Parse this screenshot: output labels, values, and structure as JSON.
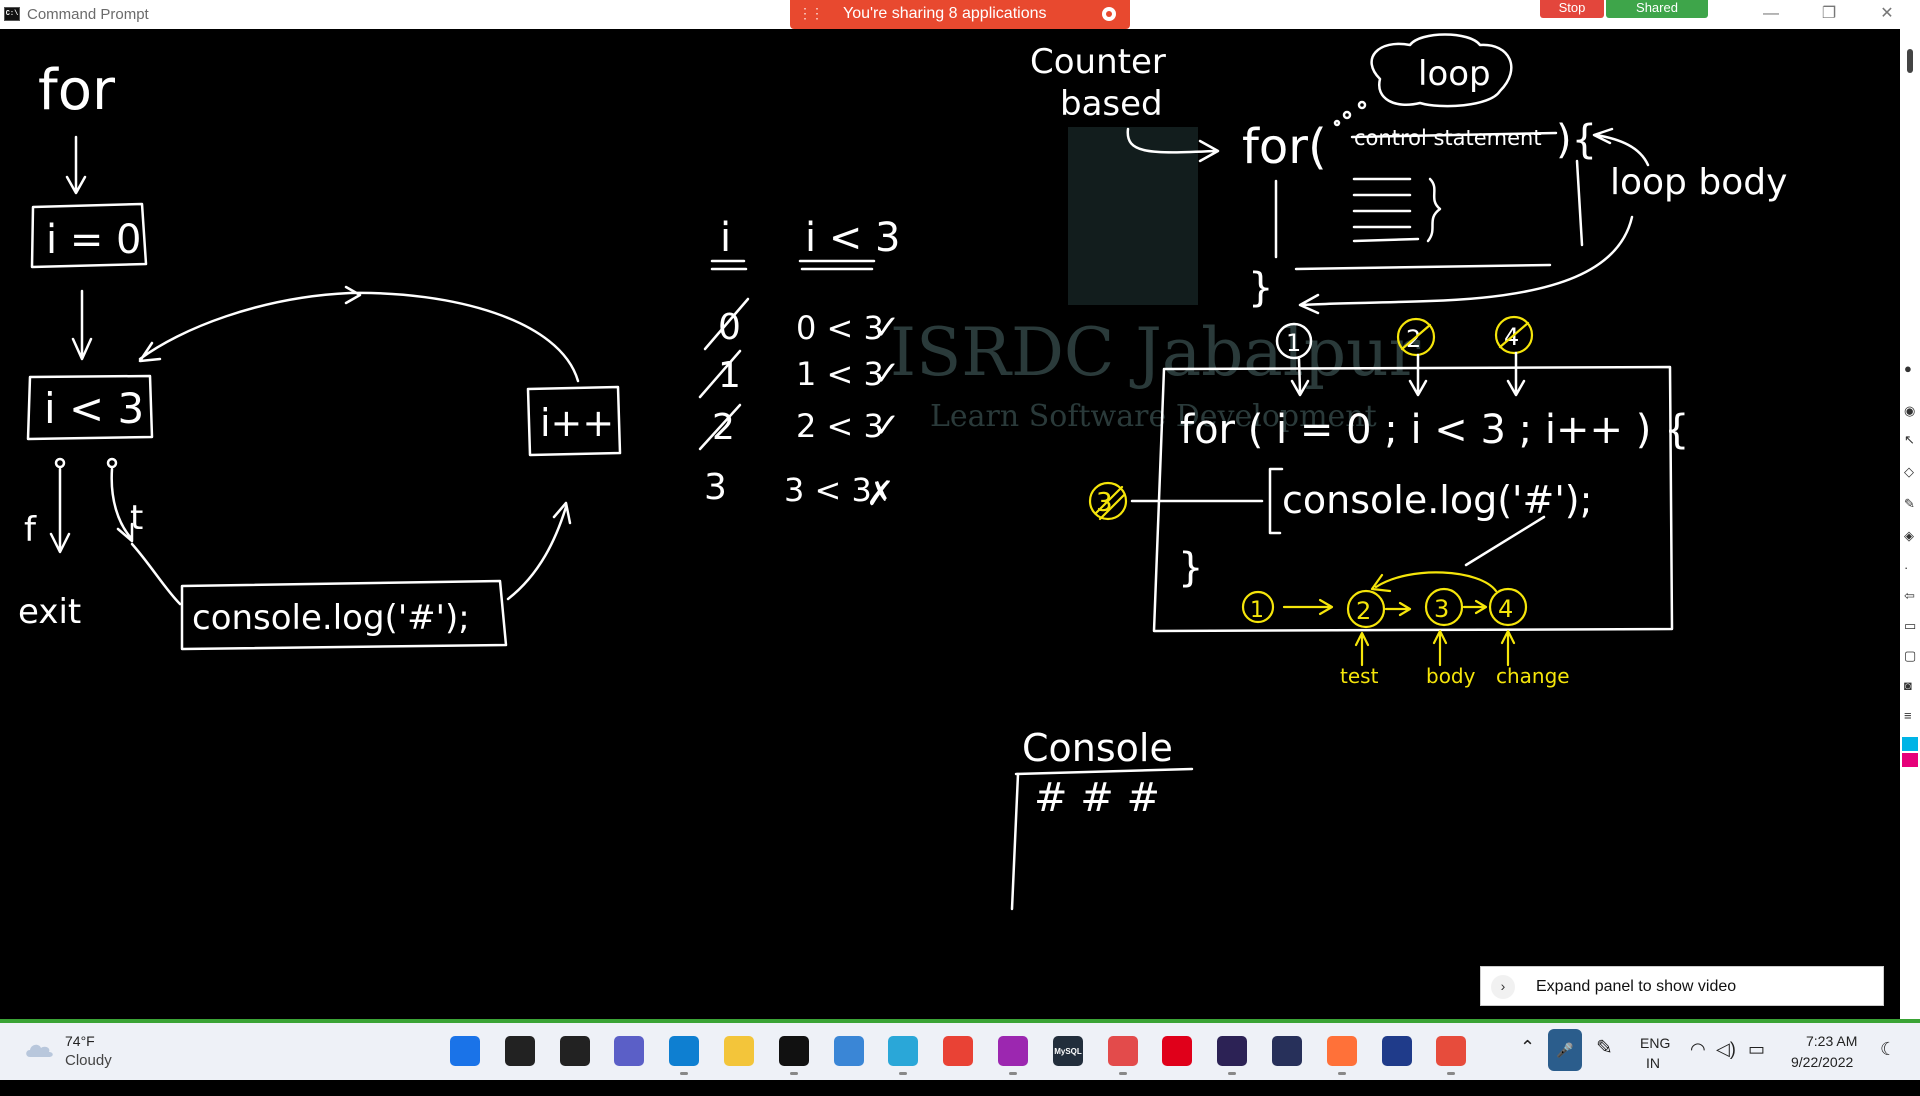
{
  "window": {
    "title": "Command Prompt",
    "icon": "cmd-icon"
  },
  "share_banner": {
    "text": "You're sharing 8 applications",
    "stop_label": "Stop",
    "shared_label": "Shared"
  },
  "window_controls": {
    "minimize": "—",
    "restore": "❐",
    "close": "✕"
  },
  "watermark": {
    "name": "ISRDC Jabalpur",
    "tagline": "Learn Software Development"
  },
  "board": {
    "flowchart": {
      "title": "for",
      "init": "i = 0",
      "condition": "i < 3",
      "update": "i++",
      "false_label": "f",
      "true_label": "t",
      "exit_label": "exit",
      "body": "console.log('#');"
    },
    "trace_table": {
      "headers": [
        "i",
        "i < 3"
      ],
      "rows": [
        {
          "i": "0",
          "test": "0 < 3",
          "result": "✓"
        },
        {
          "i": "1",
          "test": "1 < 3",
          "result": "✓"
        },
        {
          "i": "2",
          "test": "2 < 3",
          "result": "✓"
        },
        {
          "i": "3",
          "test": "3 < 3",
          "result": "✗"
        }
      ]
    },
    "syntax": {
      "counter_based": [
        "Counter",
        "based"
      ],
      "keyword": "for(",
      "control_statement": "control statement",
      "brace": "){",
      "close_brace": "}",
      "loop_cloud": "loop",
      "loop_body_label": "loop body"
    },
    "example": {
      "markers": [
        "1",
        "2",
        "4"
      ],
      "side_marker": "3",
      "header": "for ( i = 0 ; i < 3 ; i++ ) {",
      "body": "console.log('#');",
      "close_brace": "}",
      "order": [
        "1",
        "2",
        "3",
        "4"
      ],
      "order_labels": [
        "test",
        "body",
        "change"
      ]
    },
    "console": {
      "title": "Console",
      "output": "# # #"
    }
  },
  "video_panel": {
    "label": "Expand panel to show video",
    "icon": "chevron-right-icon"
  },
  "taskbar": {
    "weather": {
      "temp": "74°F",
      "desc": "Cloudy",
      "icon": "cloud-icon"
    },
    "apps": [
      {
        "name": "start-icon",
        "color": "#1a73e8",
        "glyph": ""
      },
      {
        "name": "search-icon",
        "color": "#222222",
        "glyph": ""
      },
      {
        "name": "task-view-icon",
        "color": "#222222",
        "glyph": ""
      },
      {
        "name": "chat-icon",
        "color": "#5b5fc7",
        "glyph": ""
      },
      {
        "name": "vscode-icon",
        "color": "#0e7fd1",
        "glyph": ""
      },
      {
        "name": "file-explorer-icon",
        "color": "#f3c53a",
        "glyph": ""
      },
      {
        "name": "terminal-icon",
        "color": "#111111",
        "glyph": ""
      },
      {
        "name": "notepad-icon",
        "color": "#3a86d6",
        "glyph": ""
      },
      {
        "name": "paint-icon",
        "color": "#2aa7d8",
        "glyph": ""
      },
      {
        "name": "chrome-icon",
        "color": "#e94235",
        "glyph": ""
      },
      {
        "name": "pen-tool-icon",
        "color": "#9c27b0",
        "glyph": ""
      },
      {
        "name": "mysql-icon",
        "color": "#222e3c",
        "glyph": "MySQL"
      },
      {
        "name": "eraser-app-icon",
        "color": "#e34b4b",
        "glyph": ""
      },
      {
        "name": "opera-icon",
        "color": "#e0001a",
        "glyph": ""
      },
      {
        "name": "eclipse-icon",
        "color": "#2c2255",
        "glyph": ""
      },
      {
        "name": "blender-icon",
        "color": "#27305a",
        "glyph": ""
      },
      {
        "name": "firefox-icon",
        "color": "#ff7139",
        "glyph": ""
      },
      {
        "name": "zoom-icon",
        "color": "#1f3b8a",
        "glyph": ""
      },
      {
        "name": "annotate-icon",
        "color": "#e74c3c",
        "glyph": ""
      }
    ],
    "tray": {
      "language": "ENG",
      "region": "IN",
      "time": "7:23 AM",
      "date": "9/22/2022"
    }
  }
}
